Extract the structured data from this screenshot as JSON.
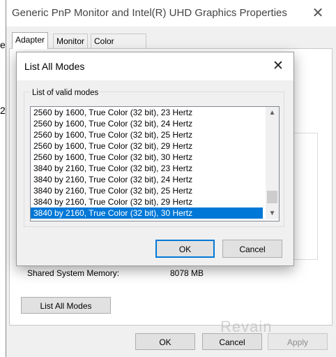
{
  "window": {
    "title": "Generic PnP Monitor and Intel(R) UHD Graphics Properties",
    "close_glyph": "✕"
  },
  "tabs": [
    {
      "label": "Adapter",
      "active": true
    },
    {
      "label": "Monitor",
      "active": false
    },
    {
      "label": "Color Management",
      "active": false
    }
  ],
  "adapter": {
    "shared_memory_label": "Shared System Memory:",
    "shared_memory_value": "8078 MB",
    "list_all_modes_label": "List All Modes"
  },
  "footer": {
    "ok_label": "OK",
    "cancel_label": "Cancel",
    "apply_label": "Apply"
  },
  "dialog": {
    "title": "List All Modes",
    "close_glyph": "✕",
    "group_label": "List of valid modes",
    "modes": [
      "2560 by 1600, True Color (32 bit), 23 Hertz",
      "2560 by 1600, True Color (32 bit), 24 Hertz",
      "2560 by 1600, True Color (32 bit), 25 Hertz",
      "2560 by 1600, True Color (32 bit), 29 Hertz",
      "2560 by 1600, True Color (32 bit), 30 Hertz",
      "3840 by 2160, True Color (32 bit), 23 Hertz",
      "3840 by 2160, True Color (32 bit), 24 Hertz",
      "3840 by 2160, True Color (32 bit), 25 Hertz",
      "3840 by 2160, True Color (32 bit), 29 Hertz",
      "3840 by 2160, True Color (32 bit), 30 Hertz"
    ],
    "selected_index": 9,
    "ok_label": "OK",
    "cancel_label": "Cancel"
  },
  "watermark": "Revain",
  "colors": {
    "selection": "#0078d7",
    "default_button_border": "#0078d7"
  }
}
